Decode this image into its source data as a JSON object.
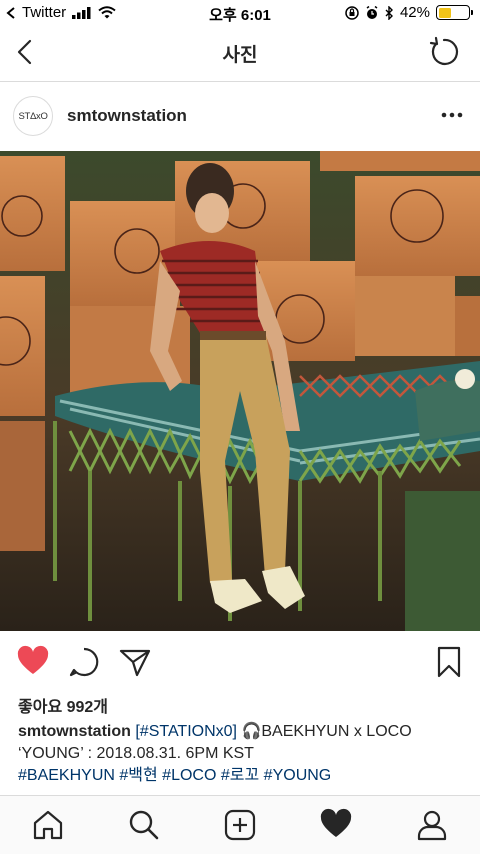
{
  "status_bar": {
    "carrier": "Twitter",
    "time": "오후 6:01",
    "battery_text": "42%",
    "battery_level": 0.42,
    "battery_color": "#f2c418"
  },
  "nav": {
    "title": "사진",
    "back_icon": "chevron-left-icon",
    "refresh_icon": "refresh-icon"
  },
  "post": {
    "avatar_text": "STΔxO",
    "username": "smtownstation",
    "more_icon": "more-horizontal-icon"
  },
  "actions": {
    "like_color": "#ed4956",
    "icons": [
      "heart-filled-icon",
      "comment-icon",
      "share-icon",
      "bookmark-icon"
    ]
  },
  "likes": {
    "text": "좋아요 992개"
  },
  "caption": {
    "username": "smtownstation",
    "tag_station": "[#STATIONx0]",
    "emoji": "🎧",
    "text_part1": "BAEKHYUN x LOCO ‘YOUNG’ : 2018.08.31. 6PM KST",
    "hashtags": [
      "#BAEKHYUN",
      "#백현",
      "#LOCO",
      "#로꼬",
      "#YOUNG"
    ]
  },
  "tab_bar": {
    "icons": [
      "home-icon",
      "search-icon",
      "new-post-icon",
      "activity-icon",
      "profile-icon"
    ]
  }
}
